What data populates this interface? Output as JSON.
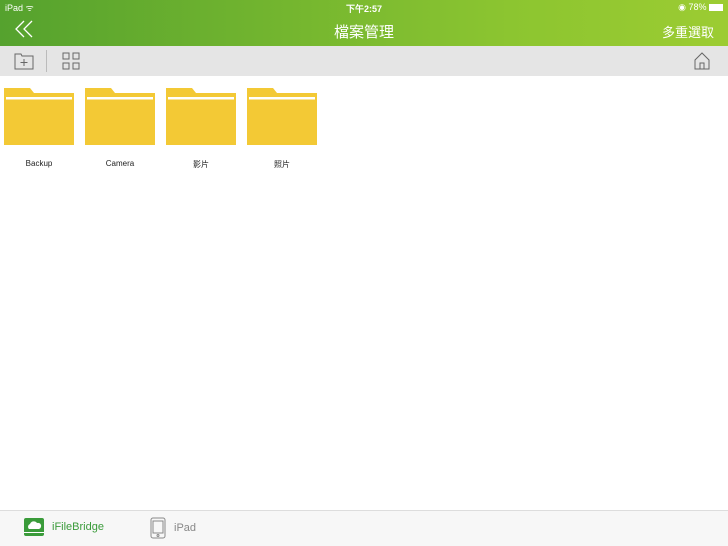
{
  "status": {
    "device": "iPad",
    "time": "下午2:57",
    "battery": "78%"
  },
  "header": {
    "title": "檔案管理",
    "multi_select": "多重選取"
  },
  "folders": [
    {
      "name": "Backup"
    },
    {
      "name": "Camera"
    },
    {
      "name": "影片"
    },
    {
      "name": "照片"
    }
  ],
  "tabs": [
    {
      "label": "iFileBridge"
    },
    {
      "label": "iPad"
    }
  ],
  "colors": {
    "accent": "#3a9b3a",
    "folder": "#f3c935"
  }
}
